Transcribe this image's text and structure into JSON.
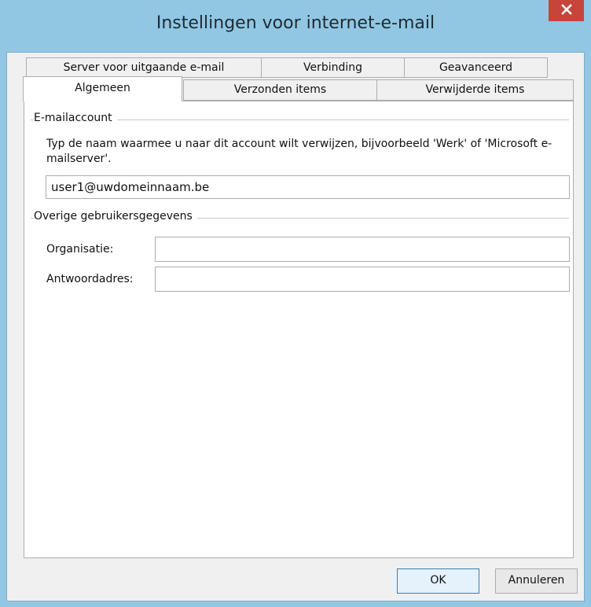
{
  "window": {
    "title": "Instellingen voor internet-e-mail"
  },
  "tabs": {
    "row_back": [
      {
        "label": "Server voor uitgaande e-mail"
      },
      {
        "label": "Verbinding"
      },
      {
        "label": "Geavanceerd"
      }
    ],
    "row_front": [
      {
        "label": "Algemeen",
        "active": true
      },
      {
        "label": "Verzonden items",
        "active": false
      },
      {
        "label": "Verwijderde items",
        "active": false
      }
    ]
  },
  "email_account": {
    "group_label": "E-mailaccount",
    "description": "Typ de naam waarmee u naar dit account wilt verwijzen, bijvoorbeeld 'Werk' of 'Microsoft e-mailserver'.",
    "account_name_value": "user1@uwdomeinnaam.be"
  },
  "user_info": {
    "group_label": "Overige gebruikersgegevens",
    "organization_label": "Organisatie:",
    "organization_value": "",
    "reply_address_label": "Antwoordadres:",
    "reply_address_value": ""
  },
  "buttons": {
    "ok_label": "OK",
    "cancel_label": "Annuleren"
  },
  "icons": {
    "close": "close-icon"
  },
  "colors": {
    "titlebar": "#91c7e3",
    "close_button": "#c7443a",
    "client_background": "#f0f0f0"
  }
}
